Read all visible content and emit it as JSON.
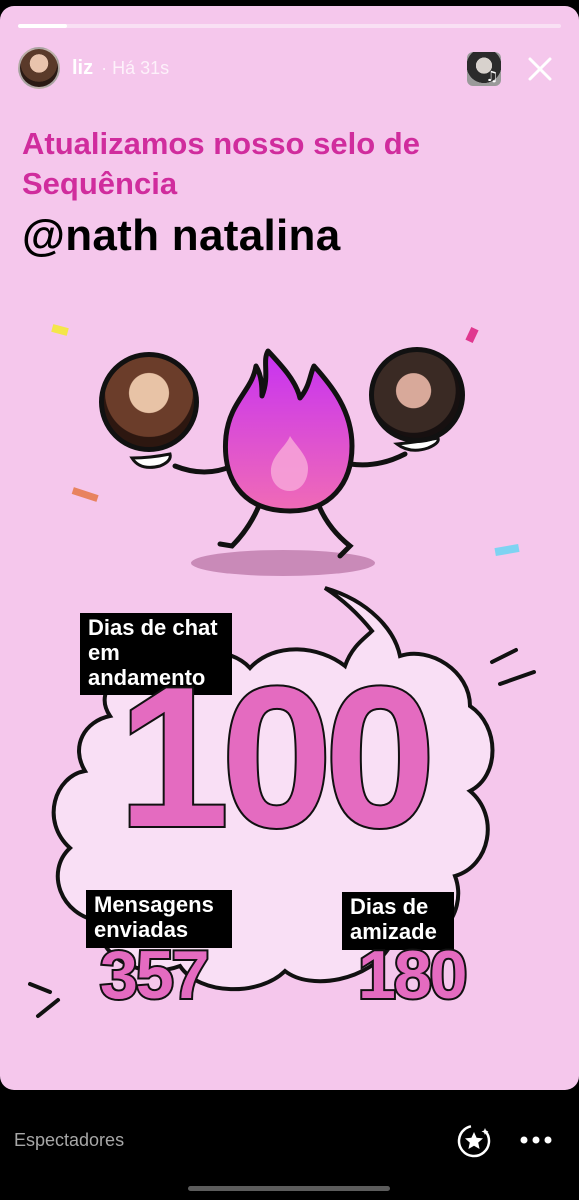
{
  "progress": {
    "fraction": 0.09
  },
  "header": {
    "username": "liz",
    "time_ago": "· Há 31s",
    "close_icon": "close-icon",
    "music_icon": "music-note-icon"
  },
  "story": {
    "headline": "Atualizamos nosso selo de Sequência",
    "friend_name": "@nath natalina",
    "streak_label": "Dias de chat em andamento",
    "streak_value": "100",
    "messages_label": "Mensagens enviadas",
    "messages_value": "357",
    "friendship_label": "Dias de amizade",
    "friendship_value": "180",
    "colors": {
      "background": "#f5c7ec",
      "accent": "#d02c9d",
      "number_fill": "#e46bc0",
      "flame_top": "#c732f2",
      "flame_bottom": "#f06bb6"
    }
  },
  "footer": {
    "viewers_label": "Espectadores",
    "star_icon": "sparkle-star-icon",
    "more_icon": "more-options-icon"
  }
}
